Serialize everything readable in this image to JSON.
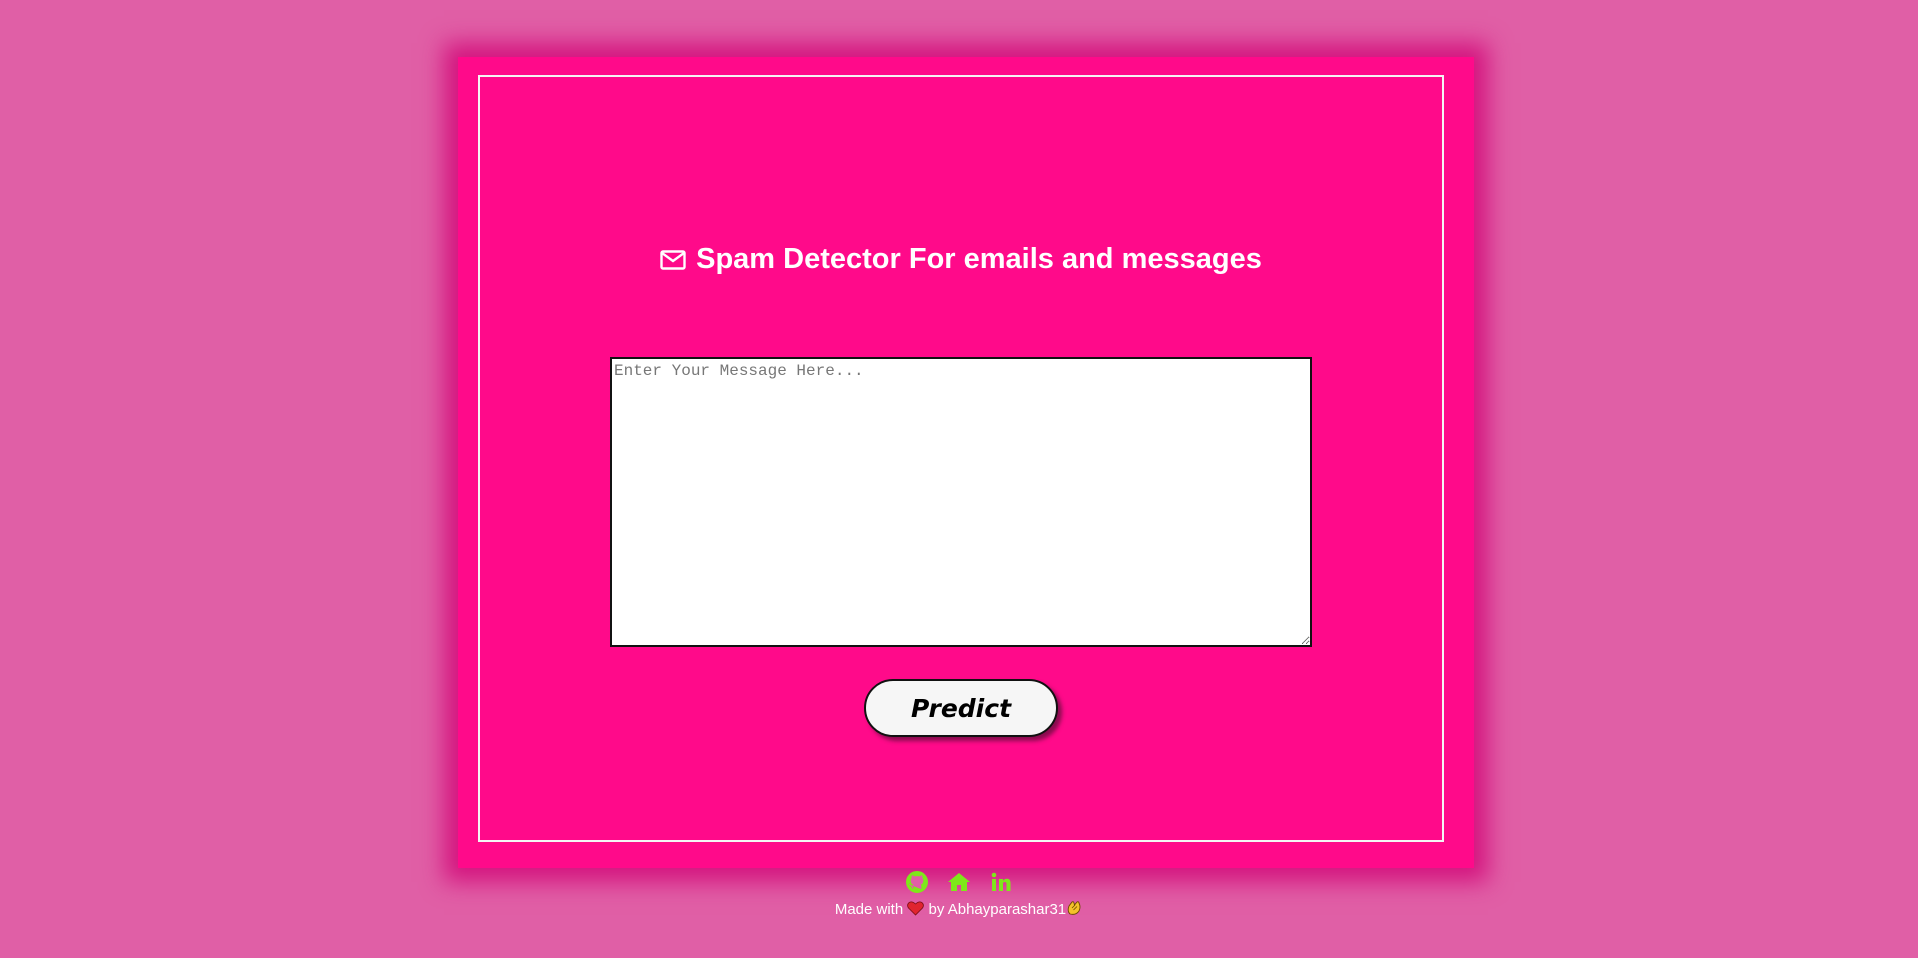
{
  "header": {
    "title": "Spam Detector For emails and messages",
    "icon": "mail-icon"
  },
  "form": {
    "message_placeholder": "Enter Your Message Here...",
    "message_value": "",
    "predict_label": "Predict"
  },
  "footer": {
    "links": [
      {
        "name": "github-icon"
      },
      {
        "name": "home-icon"
      },
      {
        "name": "linkedin-icon"
      }
    ],
    "made_with": "Made with",
    "by_text": "by Abhayparashar31",
    "heart_icon": "heart-icon",
    "clap_icon": "clapping-hands-icon"
  },
  "colors": {
    "page_background": "#e05fa6",
    "card_background": "#ff0a8a",
    "footer_icon": "#7ee81a",
    "title_text": "#ffffff"
  }
}
